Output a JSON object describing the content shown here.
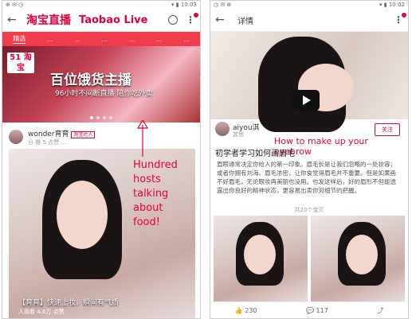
{
  "left": {
    "statusbar": {
      "left": "⊕ ✉ ◷",
      "right": "▾ ▮ 10:03"
    },
    "nav": {
      "logo_cn": "淘宝直播",
      "logo_en": "Taobao Live"
    },
    "tabs": [
      "精选",
      "...",
      "...",
      "...",
      "...",
      "...",
      "..."
    ],
    "banner": {
      "badge": "51 淘宝",
      "title": "百位饿货主播",
      "subtitle": "96小时不间断直播 陪你吃外卖"
    },
    "host": {
      "name": "wonder育育",
      "tag": "淘宝达人",
      "meta": "分 推 5 点赞 …"
    },
    "video": {
      "caption": "【育育】快速上妆，瞬间有气质",
      "viewers": "人观看 4.6万 点赞"
    },
    "annotation": [
      "Hundred hosts",
      "talking about",
      "food!"
    ]
  },
  "right": {
    "statusbar": {
      "left": "◷ ✉ ⊕",
      "right": "▾ ▮ 10:02"
    },
    "nav": {
      "title": "详情"
    },
    "author": {
      "name": "aiyou淇",
      "meta": "其他",
      "follow": "关注"
    },
    "title_en": "How to make up your eyebrow",
    "title_cn": "初学者学习如何画眉毛",
    "body": "眉眼通常决定你给人的第一印象。眉毛长是让我们忽略的一处妆容；或者你拥有刘海、眉毛浓密，让你食觉得眉毛并不重要。但是如果画不好眉毛，无论眼妆再美丽也没用。也发这样后，好的眉形不但能透露出你良好的精神状态，更容易出卖你对细节的把握。",
    "bb_label": "共20个宝贝",
    "footer": {
      "likes": "230",
      "comments": "117"
    }
  }
}
